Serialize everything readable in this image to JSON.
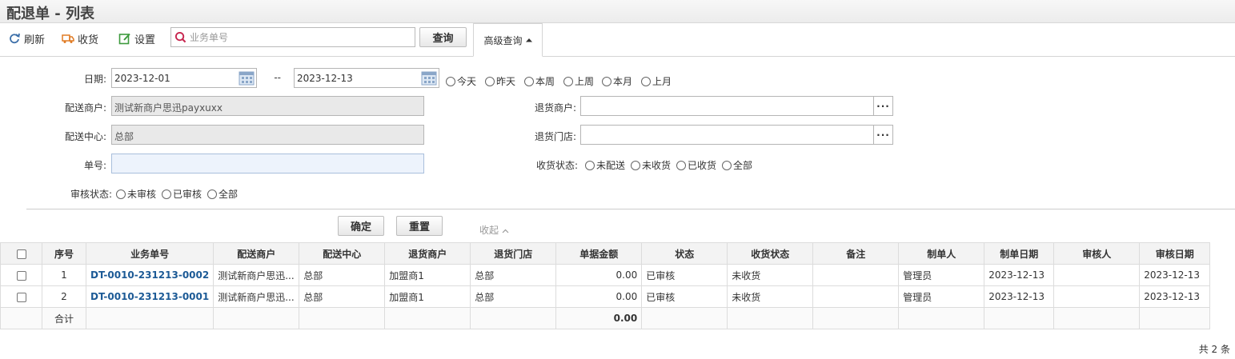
{
  "page": {
    "title": "配退单 - 列表"
  },
  "toolbar": {
    "refresh": "刷新",
    "receive": "收货",
    "settings": "设置",
    "search_placeholder": "业务单号",
    "search_value": "",
    "query": "查询",
    "advanced": "高级查询"
  },
  "filters": {
    "date_label": "日期:",
    "date_from": "2023-12-01",
    "date_sep": "--",
    "date_to": "2023-12-13",
    "date_quick": [
      "今天",
      "昨天",
      "本周",
      "上周",
      "本月",
      "上月"
    ],
    "merchant_label": "配送商户:",
    "merchant_value": "测试新商户思迅payxuxx",
    "center_label": "配送中心:",
    "center_value": "总部",
    "order_label": "单号:",
    "order_value": "",
    "audit_label": "审核状态:",
    "audit_options": [
      "未审核",
      "已审核",
      "全部"
    ],
    "return_merchant_label": "退货商户:",
    "return_merchant_value": "",
    "return_store_label": "退货门店:",
    "return_store_value": "",
    "receive_label": "收货状态:",
    "receive_options": [
      "未配送",
      "未收货",
      "已收货",
      "全部"
    ],
    "confirm": "确定",
    "reset": "重置",
    "collapse": "收起"
  },
  "table": {
    "columns": [
      "序号",
      "业务单号",
      "配送商户",
      "配送中心",
      "退货商户",
      "退货门店",
      "单据金额",
      "状态",
      "收货状态",
      "备注",
      "制单人",
      "制单日期",
      "审核人",
      "审核日期"
    ],
    "rows": [
      [
        "1",
        "DT-0010-231213-0002",
        "测试新商户思迅...",
        "总部",
        "加盟商1",
        "总部",
        "0.00",
        "已审核",
        "未收货",
        "",
        "管理员",
        "2023-12-13",
        "",
        "2023-12-13"
      ],
      [
        "2",
        "DT-0010-231213-0001",
        "测试新商户思迅...",
        "总部",
        "加盟商1",
        "总部",
        "0.00",
        "已审核",
        "未收货",
        "",
        "管理员",
        "2023-12-13",
        "",
        "2023-12-13"
      ]
    ],
    "summary_label": "合计",
    "summary_amount": "0.00"
  },
  "footer": {
    "count": "共 2 条"
  }
}
